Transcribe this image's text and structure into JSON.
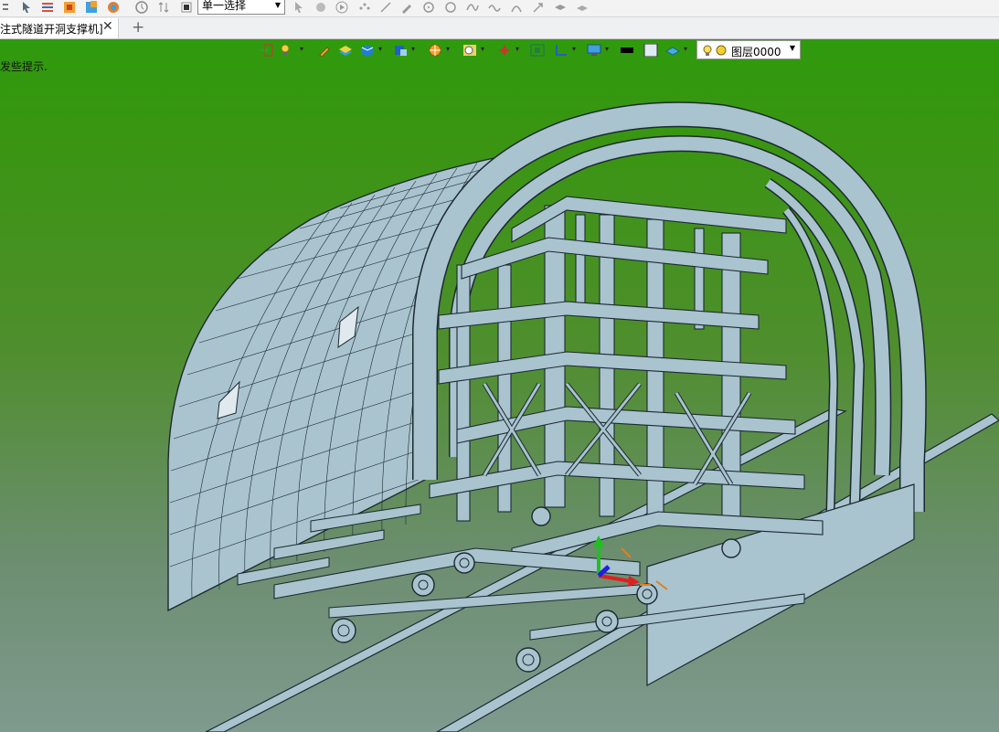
{
  "toolbar": {
    "selection_mode": "单一选择"
  },
  "document": {
    "tab_title": "注式隧道开洞支撑机]",
    "close_symbol": "✕",
    "add_tab_symbol": "+"
  },
  "viewport": {
    "hint_text": "发些提示.",
    "layer_name": "图层0000",
    "background_top": "#2f9a0d",
    "background_bottom": "#7f9a8e",
    "model_color": "#a9c3cf"
  },
  "icons": {
    "top_toolbar": [
      "list-icon",
      "pointer-icon",
      "layers-icon",
      "import-icon",
      "export-icon",
      "settings-icon",
      "clock-icon",
      "arrows-icon",
      "stop-icon",
      "cursor-icon",
      "select-icon",
      "play-icon",
      "points-icon",
      "line-icon",
      "pen-icon",
      "circle-icon",
      "circle-outline-icon",
      "curve-icon",
      "wave-icon",
      "arc-icon",
      "arrow-icon",
      "stack-icon",
      "surface-icon"
    ],
    "view_toolbar": [
      "exit-icon",
      "light-icon",
      "brush-icon",
      "layers-color-icon",
      "cube-icon",
      "view-cube-icon",
      "sun-icon",
      "zoom-icon",
      "axis-icon",
      "frame-icon",
      "ruler-icon",
      "monitor-icon",
      "black-fill-icon",
      "white-fill-icon",
      "plane-icon"
    ]
  }
}
